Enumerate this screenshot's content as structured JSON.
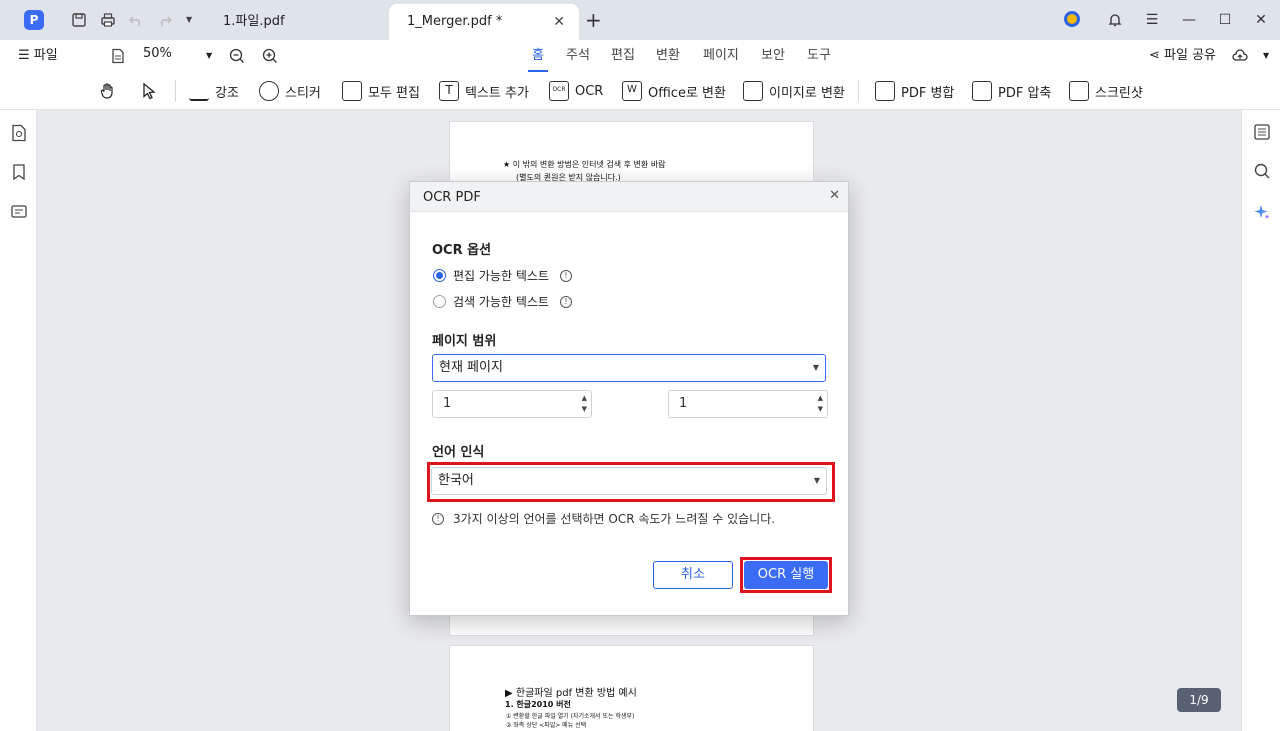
{
  "titlebar": {
    "logo": "P",
    "tabs": [
      {
        "label": "1.파일.pdf",
        "active": false
      },
      {
        "label": "1_Merger.pdf *",
        "active": true
      }
    ],
    "icons": [
      "save-icon",
      "print-icon",
      "undo-icon",
      "redo-icon",
      "dropdown-icon",
      "new-tab-icon",
      "avatar-icon",
      "bell-icon",
      "hamburger-icon",
      "minimize-icon",
      "maximize-icon",
      "close-icon"
    ]
  },
  "menubar": {
    "file_menu": "파일",
    "zoom": "50%",
    "nav_tabs": [
      "홈",
      "주석",
      "편집",
      "변환",
      "페이지",
      "보안",
      "도구"
    ],
    "active_nav": "홈",
    "share": "파일 공유"
  },
  "toolbar": {
    "tools": [
      "강조",
      "스티커",
      "모두 편집",
      "텍스트 추가",
      "OCR",
      "Office로 변환",
      "이미지로 변환",
      "PDF 병합",
      "PDF 압축",
      "스크린샷"
    ]
  },
  "document": {
    "page1_lines": [
      "★ 이 밖의 변환 방법은 인터넷 검색 후 변환 바람",
      "(별도의 퀸원은 받지 않습니다.)"
    ],
    "page2_lines": [
      "▶ 한글파일 pdf 변환 방법 예시",
      "1. 한글2010 버전",
      "① 변환할 한글 파일 열기 (자기소개서 또는 학생부)",
      "② 좌측 상단 <파일> 메뉴 선택"
    ],
    "page_indicator": "1/9"
  },
  "dialog": {
    "title": "OCR PDF",
    "ocr_options_title": "OCR 옵션",
    "option_editable": "편집 가능한 텍스트",
    "option_searchable": "검색 가능한 텍스트",
    "selected_option": "editable",
    "page_range_title": "페이지 범위",
    "page_range_value": "현재 페이지",
    "range_from": "1",
    "range_to": "1",
    "language_title": "언어 인식",
    "language_value": "한국어",
    "note": "3가지 이상의 언어를 선택하면 OCR 속도가 느려질 수 있습니다.",
    "cancel": "취소",
    "run": "OCR 실행"
  },
  "colors": {
    "accent": "#3b6cf6",
    "highlight": "#e0141e"
  }
}
